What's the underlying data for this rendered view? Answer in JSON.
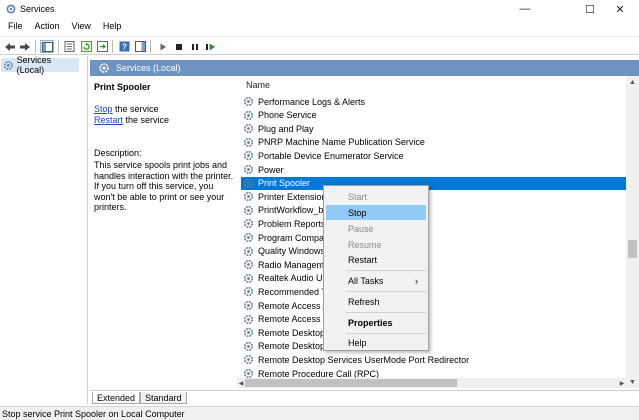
{
  "window": {
    "title": "Services",
    "minimize": "—",
    "maximize": "☐",
    "close": "✕"
  },
  "menu": [
    "File",
    "Action",
    "View",
    "Help"
  ],
  "toolbar_icons": [
    "back-icon",
    "forward-icon",
    "show-hide-tree-icon",
    "properties-icon",
    "refresh-icon",
    "export-list-icon",
    "help-icon",
    "show-action-pane-icon",
    "start-service-icon",
    "stop-service-icon",
    "pause-service-icon",
    "restart-service-icon"
  ],
  "tree": {
    "root": "Services (Local)"
  },
  "panel": {
    "header": "Services (Local)",
    "selected_service": "Print Spooler",
    "stop_link": "Stop",
    "stop_suffix": " the service",
    "restart_link": "Restart",
    "restart_suffix": " the service",
    "description_label": "Description:",
    "description": "This service spools print jobs and handles interaction with the printer. If you turn off this service, you won't be able to print or see your printers."
  },
  "list": {
    "column": "Name",
    "rows": [
      "Performance Logs & Alerts",
      "Phone Service",
      "Plug and Play",
      "PNRP Machine Name Publication Service",
      "Portable Device Enumerator Service",
      "Power",
      "Print Spooler",
      "Printer Extensions",
      "PrintWorkflow_b5",
      "Problem Reports",
      "Program Compat",
      "Quality Windows",
      "Radio Manageme",
      "Realtek Audio Ur",
      "Recommended T",
      "Remote Access A",
      "Remote Access C",
      "Remote Desktop",
      "Remote Desktop",
      "Remote Desktop Services UserMode Port Redirector",
      "Remote Procedure Call (RPC)"
    ],
    "selected_index": 6
  },
  "context_menu": {
    "start": "Start",
    "stop": "Stop",
    "pause": "Pause",
    "resume": "Resume",
    "restart": "Restart",
    "all_tasks": "All Tasks",
    "all_tasks_arrow": "›",
    "refresh": "Refresh",
    "properties": "Properties",
    "help": "Help"
  },
  "tabs": {
    "extended": "Extended",
    "standard": "Standard"
  },
  "status": "Stop service Print Spooler on Local Computer",
  "colors": {
    "header_band": "#6f93c1",
    "selection": "#0078d7",
    "menu_highlight": "#91c9f7",
    "link": "#1a4ab2"
  }
}
